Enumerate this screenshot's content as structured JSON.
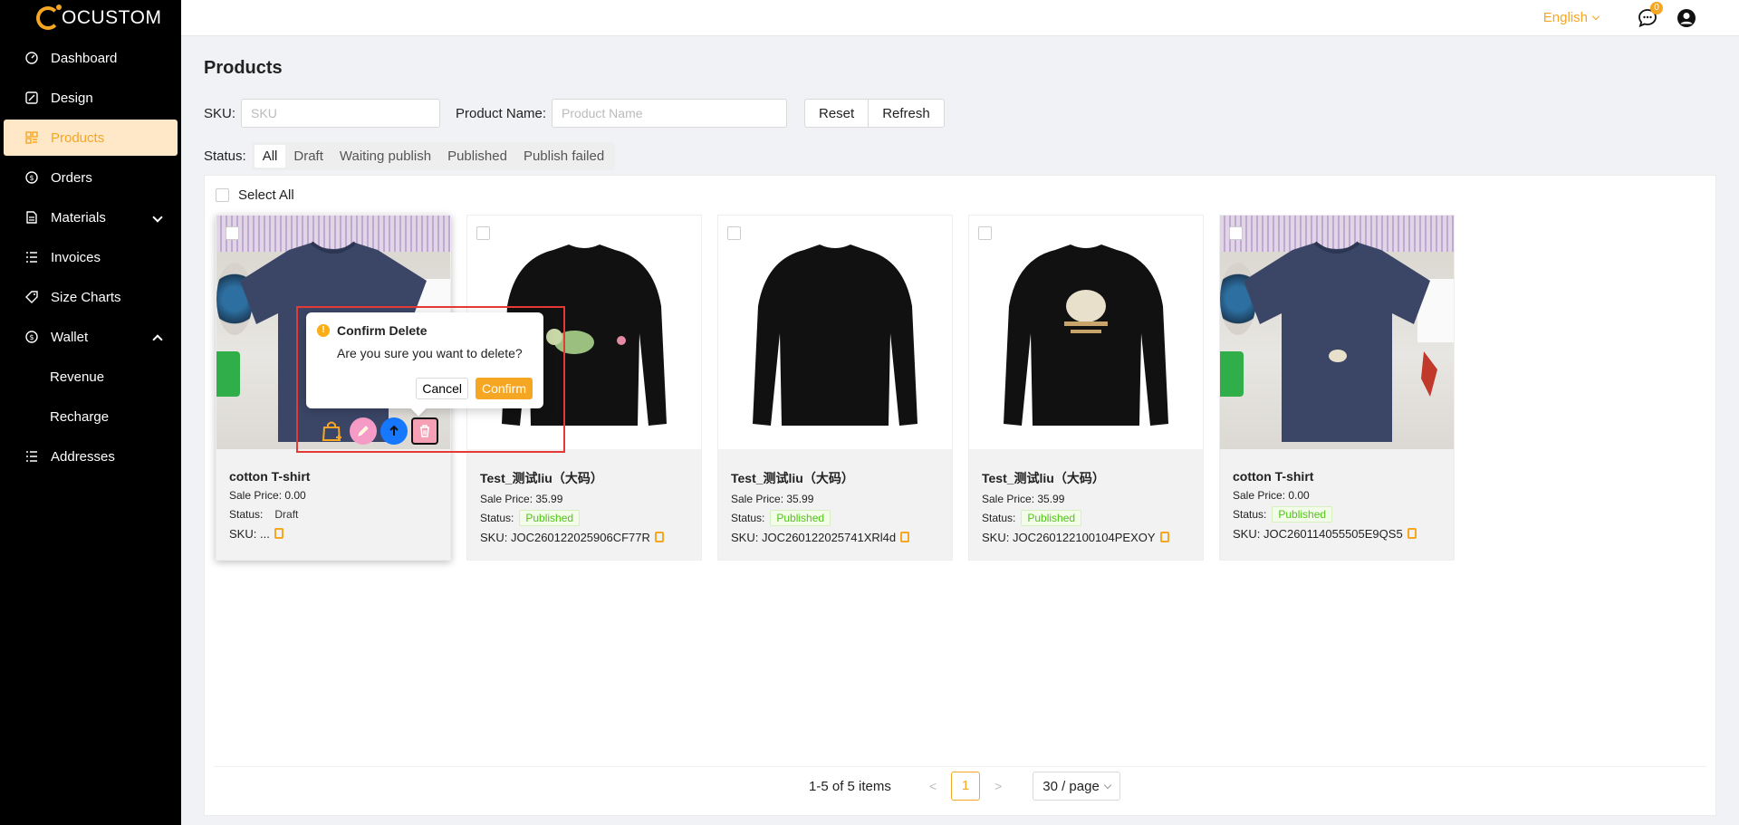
{
  "app": {
    "logo_text": "OCUSTOM"
  },
  "sidebar": {
    "items": [
      {
        "label": "Dashboard",
        "icon": "dashboard-icon"
      },
      {
        "label": "Design",
        "icon": "design-icon"
      },
      {
        "label": "Products",
        "icon": "products-icon",
        "active": true
      },
      {
        "label": "Orders",
        "icon": "orders-icon"
      },
      {
        "label": "Materials",
        "icon": "materials-icon"
      },
      {
        "label": "Invoices",
        "icon": "invoices-icon"
      },
      {
        "label": "Size Charts",
        "icon": "tag-icon"
      },
      {
        "label": "Wallet",
        "icon": "wallet-icon"
      },
      {
        "label": "Revenue"
      },
      {
        "label": "Recharge"
      },
      {
        "label": "Addresses",
        "icon": "addresses-icon"
      }
    ]
  },
  "header": {
    "language": "English",
    "message_count": "0"
  },
  "page": {
    "title": "Products"
  },
  "filters": {
    "sku_label": "SKU",
    "sku_placeholder": "SKU",
    "name_label": "Product Name",
    "name_placeholder": "Product Name",
    "reset": "Reset",
    "refresh": "Refresh"
  },
  "status_filter": {
    "label": "Status:",
    "options": [
      "All",
      "Draft",
      "Waiting publish",
      "Published",
      "Publish failed"
    ],
    "selected": "All"
  },
  "select_all": "Select All",
  "card_labels": {
    "sale_price": "Sale Price:",
    "status": "Status:",
    "sku": "SKU:"
  },
  "products": [
    {
      "name": "cotton T-shirt",
      "price": "0.00",
      "status": "Draft",
      "sku": "..."
    },
    {
      "name": "Test_测试liu（大码）",
      "price": "35.99",
      "status": "Published",
      "sku": "JOC260122025906CF77R"
    },
    {
      "name": "Test_测试liu（大码）",
      "price": "35.99",
      "status": "Published",
      "sku": "JOC260122025741XRl4d"
    },
    {
      "name": "Test_测试liu（大码）",
      "price": "35.99",
      "status": "Published",
      "sku": "JOC260122100104PEXOY"
    },
    {
      "name": "cotton T-shirt",
      "price": "0.00",
      "status": "Published",
      "sku": "JOC260114055505E9QS5"
    }
  ],
  "popconfirm": {
    "title": "Confirm Delete",
    "description": "Are you sure you want to delete?",
    "cancel": "Cancel",
    "confirm": "Confirm"
  },
  "pagination": {
    "total_text": "1-5 of 5 items",
    "current_page": "1",
    "page_size": "30 / page"
  },
  "colors": {
    "accent": "#f5a623",
    "sidebar_bg": "#000000",
    "published": "#52c41a"
  }
}
